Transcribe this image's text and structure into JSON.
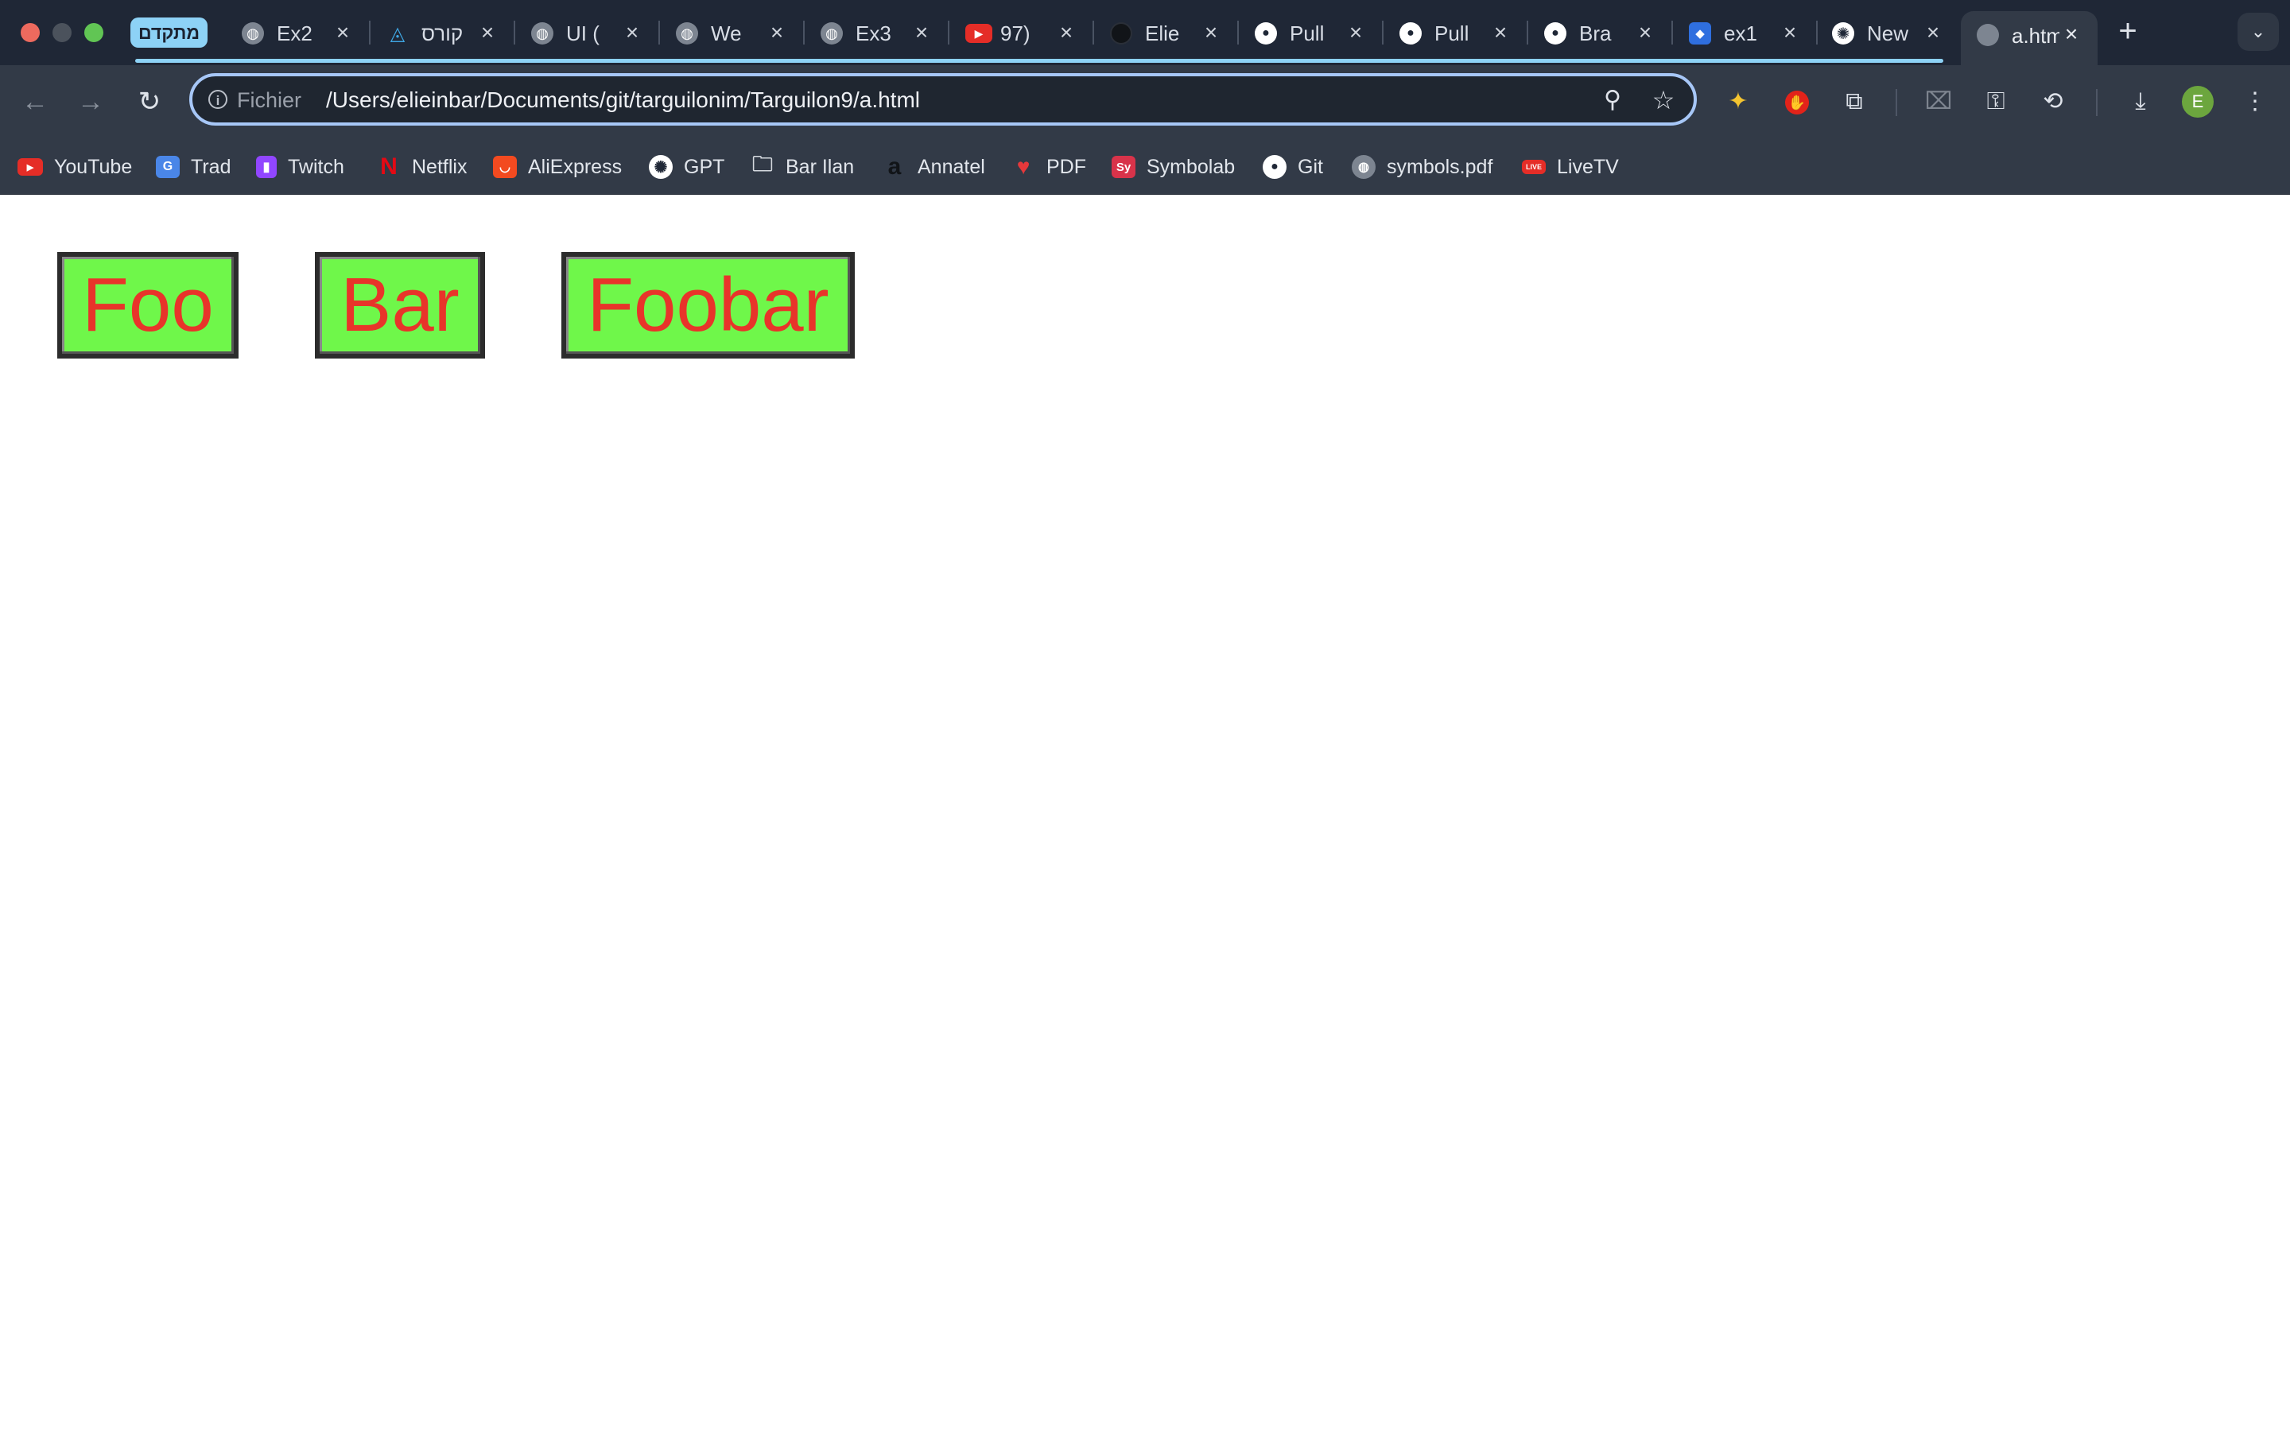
{
  "tab_strip": {
    "group_label": "מתקדם",
    "tabs": [
      {
        "title": "Ex2",
        "icon": "globe-icon",
        "color": "#7d8591"
      },
      {
        "title": "קורס",
        "icon": "drive-icon",
        "color": "#1f2736"
      },
      {
        "title": "UI (",
        "icon": "globe-icon",
        "color": "#7d8591"
      },
      {
        "title": "We",
        "icon": "globe-icon",
        "color": "#7d8591"
      },
      {
        "title": "Ex3",
        "icon": "globe-icon",
        "color": "#7d8591"
      },
      {
        "title": "97)",
        "icon": "youtube-icon",
        "color": "#e52d27"
      },
      {
        "title": "Elie",
        "icon": "github-icon",
        "color": "#111418"
      },
      {
        "title": "Pull",
        "icon": "github-icon",
        "color": "#ffffff"
      },
      {
        "title": "Pull",
        "icon": "github-icon",
        "color": "#ffffff"
      },
      {
        "title": "Bra",
        "icon": "github-icon",
        "color": "#ffffff"
      },
      {
        "title": "ex1",
        "icon": "jira-icon",
        "color": "#2f6fdf"
      },
      {
        "title": "New",
        "icon": "openai-icon",
        "color": "#ffffff"
      }
    ],
    "active_tab": {
      "title": "a.html",
      "icon": "globe-icon"
    },
    "new_tab_glyph": "+",
    "tab_search_glyph": "⌄"
  },
  "toolbar": {
    "back_glyph": "←",
    "forward_glyph": "→",
    "reload_glyph": "↻",
    "scheme_label": "Fichier",
    "url": "/Users/elieinbar/Documents/git/targuilonim/Targuilon9/a.html",
    "avatar_letter": "E"
  },
  "bookmarks": [
    {
      "label": "YouTube",
      "icon": "youtube-icon",
      "color": "#e52d27"
    },
    {
      "label": "Trad",
      "icon": "translate-icon",
      "color": "#4a86e8"
    },
    {
      "label": "Twitch",
      "icon": "twitch-icon",
      "color": "#9146ff"
    },
    {
      "label": "Netflix",
      "icon": "netflix-icon",
      "color": "#e50914"
    },
    {
      "label": "AliExpress",
      "icon": "aliexpress-icon",
      "color": "#f34a20"
    },
    {
      "label": "GPT",
      "icon": "openai-icon",
      "color": "#ffffff"
    },
    {
      "label": "Bar Ilan",
      "icon": "folder-icon",
      "color": "#d5d9df"
    },
    {
      "label": "Annatel",
      "icon": "annatel-icon",
      "color": "#111418"
    },
    {
      "label": "PDF",
      "icon": "pdf-heart-icon",
      "color": "#e5383b"
    },
    {
      "label": "Symbolab",
      "icon": "symbolab-icon",
      "color": "#d8334a"
    },
    {
      "label": "Git",
      "icon": "github-icon",
      "color": "#ffffff"
    },
    {
      "label": "symbols.pdf",
      "icon": "globe-icon",
      "color": "#7d8591"
    },
    {
      "label": "LiveTV",
      "icon": "livetv-icon",
      "color": "#e52d27"
    }
  ],
  "page": {
    "buttons": [
      {
        "label": "Foo"
      },
      {
        "label": "Bar"
      },
      {
        "label": "Foobar"
      }
    ],
    "button_colors": {
      "background": "#6ff74a",
      "text": "#e8342a",
      "border": "#2c2c2c"
    }
  }
}
